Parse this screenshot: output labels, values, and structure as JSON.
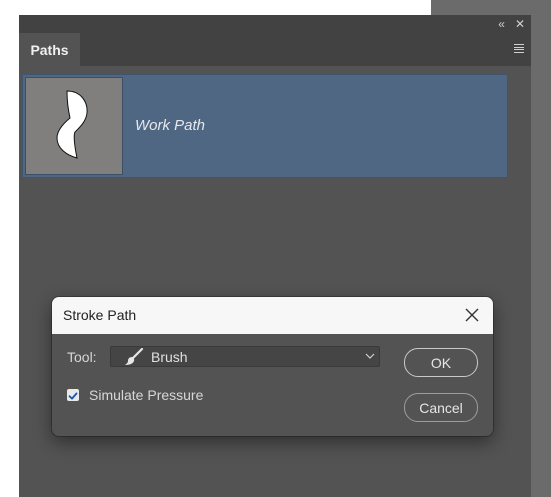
{
  "panel": {
    "tab": "Paths",
    "collapse_glyph": "«",
    "close_glyph": "✕",
    "menu_icon": "hamburger-icon",
    "paths": [
      {
        "name": "Work Path"
      }
    ]
  },
  "dialog": {
    "title": "Stroke Path",
    "tool_label": "Tool:",
    "tool_value": "Brush",
    "tool_icon": "brush-icon",
    "simulate_pressure_label": "Simulate Pressure",
    "simulate_pressure_checked": true,
    "ok_label": "OK",
    "cancel_label": "Cancel"
  },
  "colors": {
    "panel_bg": "#535353",
    "selected_row": "#4f6782",
    "dialog_header": "#f7f7f7"
  }
}
